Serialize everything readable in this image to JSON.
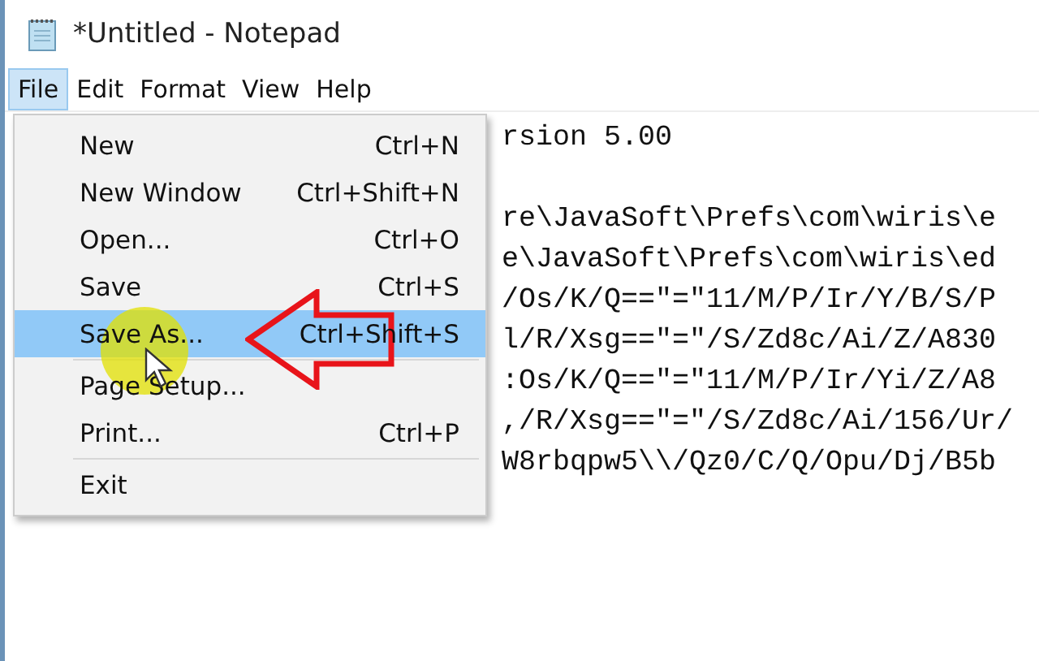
{
  "window": {
    "title": "*Untitled - Notepad"
  },
  "menu_bar": [
    {
      "label": "File",
      "selected": true
    },
    {
      "label": "Edit",
      "selected": false
    },
    {
      "label": "Format",
      "selected": false
    },
    {
      "label": "View",
      "selected": false
    },
    {
      "label": "Help",
      "selected": false
    }
  ],
  "file_menu": [
    {
      "kind": "item",
      "label": "New",
      "shortcut": "Ctrl+N",
      "selected": false
    },
    {
      "kind": "item",
      "label": "New Window",
      "shortcut": "Ctrl+Shift+N",
      "selected": false
    },
    {
      "kind": "item",
      "label": "Open...",
      "shortcut": "Ctrl+O",
      "selected": false
    },
    {
      "kind": "item",
      "label": "Save",
      "shortcut": "Ctrl+S",
      "selected": false
    },
    {
      "kind": "item",
      "label": "Save As...",
      "shortcut": "Ctrl+Shift+S",
      "selected": true
    },
    {
      "kind": "separator"
    },
    {
      "kind": "item",
      "label": "Page Setup...",
      "selected": false
    },
    {
      "kind": "item",
      "label": "Print...",
      "shortcut": "Ctrl+P",
      "selected": false
    },
    {
      "kind": "separator"
    },
    {
      "kind": "item",
      "label": "Exit",
      "selected": false
    }
  ],
  "editor": {
    "paragraphs": [
      [
        "rsion 5.00"
      ],
      [
        "re\\JavaSoft\\Prefs\\com\\wiris\\e",
        "e\\JavaSoft\\Prefs\\com\\wiris\\ed",
        "/Os/K/Q==\"=\"11/M/P/Ir/Y/B/S/P",
        "l/R/Xsg==\"=\"/S/Zd8c/Ai/Z/A830",
        ":Os/K/Q==\"=\"11/M/P/Ir/Yi/Z/A8",
        ",/R/Xsg==\"=\"/S/Zd8c/Ai/156/Ur/",
        "W8rbqpw5\\\\/Qz0/C/Q/Opu/Dj/B5b"
      ]
    ]
  }
}
